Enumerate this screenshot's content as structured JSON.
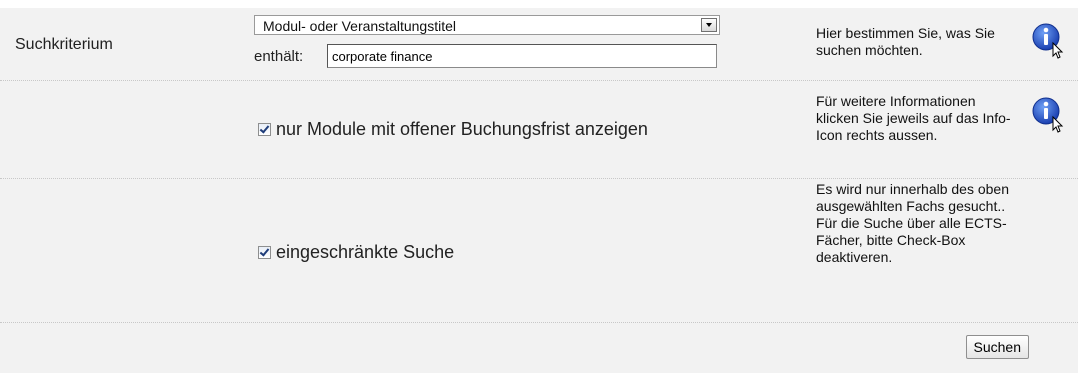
{
  "criterion": {
    "label": "Suchkriterium",
    "select_value": "Modul- oder Veranstaltungstitel",
    "contains_label": "enthält:",
    "contains_value": "corporate finance",
    "help": "Hier bestimmen Sie, was Sie suchen möchten."
  },
  "open_deadline": {
    "label": "nur Module mit offener Buchungsfrist anzeigen",
    "checked": true,
    "help": "Für weitere Informationen klicken Sie jeweils auf das Info-Icon rechts aussen."
  },
  "restricted": {
    "label": "eingeschränkte Suche",
    "checked": true,
    "help": "Es wird nur innerhalb des oben ausgewählten Fachs gesucht.. Für die Suche über alle ECTS-Fächer, bitte Check-Box deaktiveren."
  },
  "submit_label": "Suchen",
  "colors": {
    "row_background": "#f2f2f2",
    "info_icon": "#1a4fc4"
  }
}
